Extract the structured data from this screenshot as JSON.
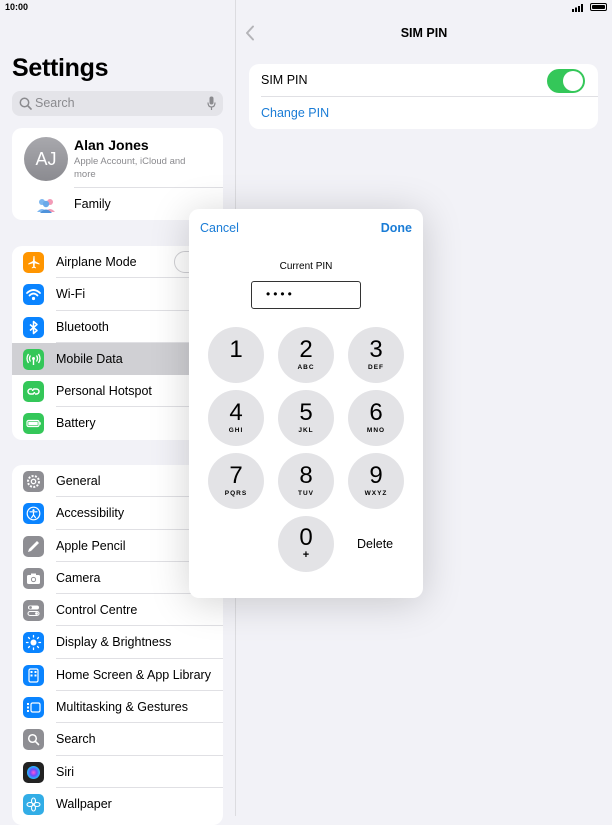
{
  "status": {
    "time": "10:00"
  },
  "sidebar": {
    "title": "Settings",
    "search_placeholder": "Search",
    "account": {
      "initials": "AJ",
      "name": "Alan Jones",
      "subtitle": "Apple Account, iCloud and more",
      "family_label": "Family"
    },
    "group1": [
      {
        "label": "Airplane Mode",
        "color": "#ff9500"
      },
      {
        "label": "Wi-Fi",
        "color": "#0a84ff"
      },
      {
        "label": "Bluetooth",
        "color": "#0a84ff"
      },
      {
        "label": "Mobile Data",
        "color": "#34c759",
        "selected": true
      },
      {
        "label": "Personal Hotspot",
        "color": "#34c759"
      },
      {
        "label": "Battery",
        "color": "#34c759"
      }
    ],
    "group2": [
      {
        "label": "General",
        "color": "#8e8e93"
      },
      {
        "label": "Accessibility",
        "color": "#0a84ff"
      },
      {
        "label": "Apple Pencil",
        "color": "#8e8e93"
      },
      {
        "label": "Camera",
        "color": "#8e8e93"
      },
      {
        "label": "Control Centre",
        "color": "#8e8e93"
      },
      {
        "label": "Display & Brightness",
        "color": "#0a84ff"
      },
      {
        "label": "Home Screen & App Library",
        "color": "#0a84ff"
      },
      {
        "label": "Multitasking & Gestures",
        "color": "#0a84ff"
      },
      {
        "label": "Search",
        "color": "#8e8e93"
      },
      {
        "label": "Siri",
        "color": "#222222"
      },
      {
        "label": "Wallpaper",
        "color": "#32ade6"
      }
    ]
  },
  "detail": {
    "title": "SIM PIN",
    "sim_pin_label": "SIM PIN",
    "sim_pin_on": true,
    "change_pin_label": "Change PIN"
  },
  "modal": {
    "cancel_label": "Cancel",
    "done_label": "Done",
    "field_label": "Current PIN",
    "pin_value": "••••",
    "delete_label": "Delete",
    "keys": [
      {
        "digit": "1",
        "letters": ""
      },
      {
        "digit": "2",
        "letters": "ABC"
      },
      {
        "digit": "3",
        "letters": "DEF"
      },
      {
        "digit": "4",
        "letters": "GHI"
      },
      {
        "digit": "5",
        "letters": "JKL"
      },
      {
        "digit": "6",
        "letters": "MNO"
      },
      {
        "digit": "7",
        "letters": "PQRS"
      },
      {
        "digit": "8",
        "letters": "TUV"
      },
      {
        "digit": "9",
        "letters": "WXYZ"
      },
      {
        "digit": "0",
        "letters": "+"
      }
    ]
  }
}
